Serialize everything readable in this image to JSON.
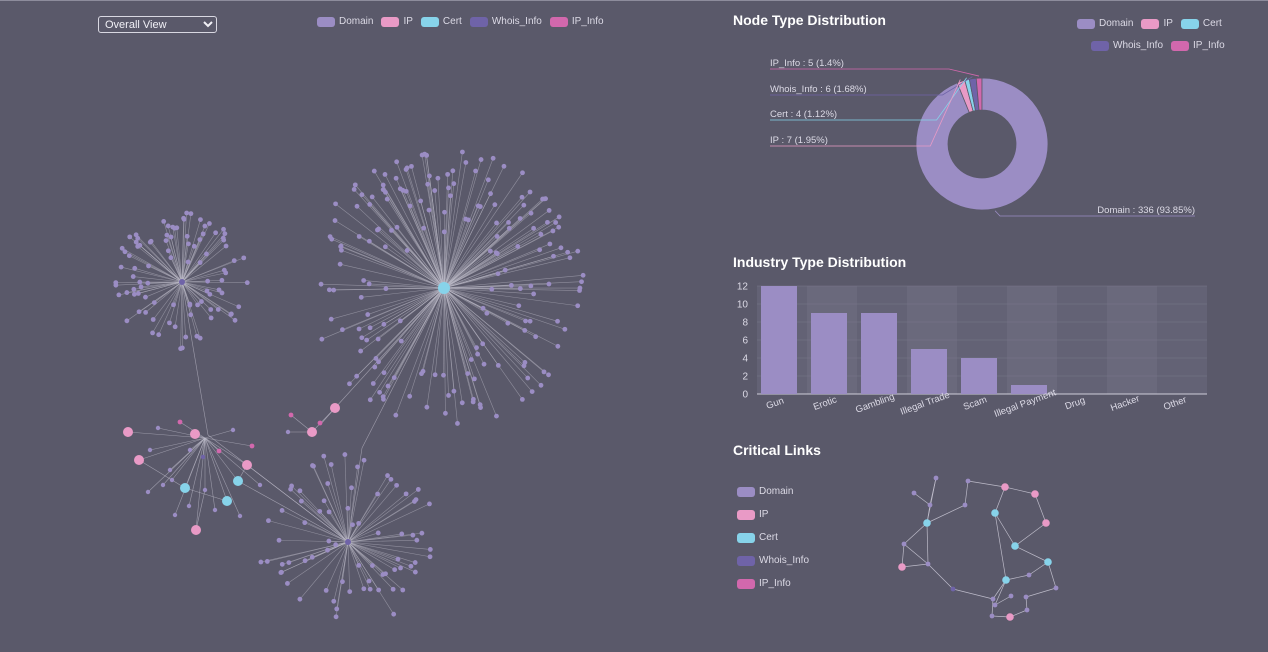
{
  "view_select": {
    "selected": "Overall View",
    "options": [
      "Overall View"
    ]
  },
  "legend": [
    {
      "label": "Domain",
      "color": "#9b8dc4"
    },
    {
      "label": "IP",
      "color": "#e99ac6"
    },
    {
      "label": "Cert",
      "color": "#87d3ea"
    },
    {
      "label": "Whois_Info",
      "color": "#6f63a8"
    },
    {
      "label": "IP_Info",
      "color": "#d268ad"
    }
  ],
  "node_type": {
    "title": "Node Type Distribution",
    "labels": [
      {
        "name": "IP_Info",
        "text": "IP_Info : 5 (1.4%)"
      },
      {
        "name": "Whois_Info",
        "text": "Whois_Info : 6 (1.68%)"
      },
      {
        "name": "Cert",
        "text": "Cert : 4 (1.12%)"
      },
      {
        "name": "IP",
        "text": "IP : 7 (1.95%)"
      },
      {
        "name": "Domain",
        "text": "Domain : 336 (93.85%)"
      }
    ]
  },
  "industry": {
    "title": "Industry Type Distribution"
  },
  "critical_links": {
    "title": "Critical Links"
  },
  "chart_data": [
    {
      "type": "pie",
      "title": "Node Type Distribution",
      "slices": [
        {
          "name": "Domain",
          "value": 336,
          "percent": 93.85,
          "color": "#9b8dc4"
        },
        {
          "name": "IP",
          "value": 7,
          "percent": 1.95,
          "color": "#e99ac6"
        },
        {
          "name": "Cert",
          "value": 4,
          "percent": 1.12,
          "color": "#87d3ea"
        },
        {
          "name": "Whois_Info",
          "value": 6,
          "percent": 1.68,
          "color": "#6f63a8"
        },
        {
          "name": "IP_Info",
          "value": 5,
          "percent": 1.4,
          "color": "#d268ad"
        }
      ],
      "legend_position": "top-right"
    },
    {
      "type": "bar",
      "title": "Industry Type Distribution",
      "categories": [
        "Gun",
        "Erotic",
        "Gambling",
        "Illegal Trade",
        "Scam",
        "Illegal Payment",
        "Drug",
        "Hacker",
        "Other"
      ],
      "values": [
        12,
        9,
        9,
        5,
        4,
        1,
        0,
        0,
        0
      ],
      "yticks": [
        "0",
        "2",
        "4",
        "6",
        "8",
        "10",
        "12"
      ],
      "ylim": [
        0,
        12
      ],
      "color": "#9b8dc4"
    }
  ]
}
